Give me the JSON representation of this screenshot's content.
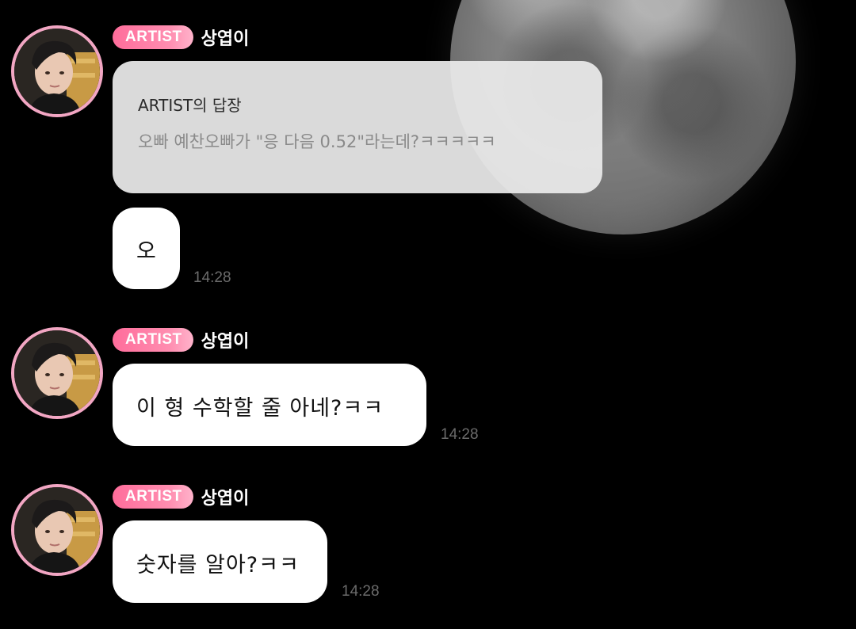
{
  "background": {
    "color": "#000000",
    "image": "full-moon"
  },
  "messages": [
    {
      "badge": "ARTIST",
      "sender": "상엽이",
      "reply": {
        "title": "ARTIST의 답장",
        "quote": "오빠 예찬오빠가 \"응 다음 0.52\"라는데?ㅋㅋㅋㅋㅋ"
      },
      "text": "오",
      "time": "14:28"
    },
    {
      "badge": "ARTIST",
      "sender": "상엽이",
      "text": "이 형 수학할 줄 아네?ㅋㅋ",
      "time": "14:28"
    },
    {
      "badge": "ARTIST",
      "sender": "상엽이",
      "text": "숫자를 알아?ㅋㅋ",
      "time": "14:28"
    }
  ],
  "colors": {
    "badge_gradient_start": "#ff6d9b",
    "badge_gradient_end": "#ffb3cb",
    "avatar_ring": "#f2a6c3",
    "bubble": "#ffffff",
    "reply_bubble": "#ebebeb",
    "timestamp": "#6b6b6b"
  }
}
